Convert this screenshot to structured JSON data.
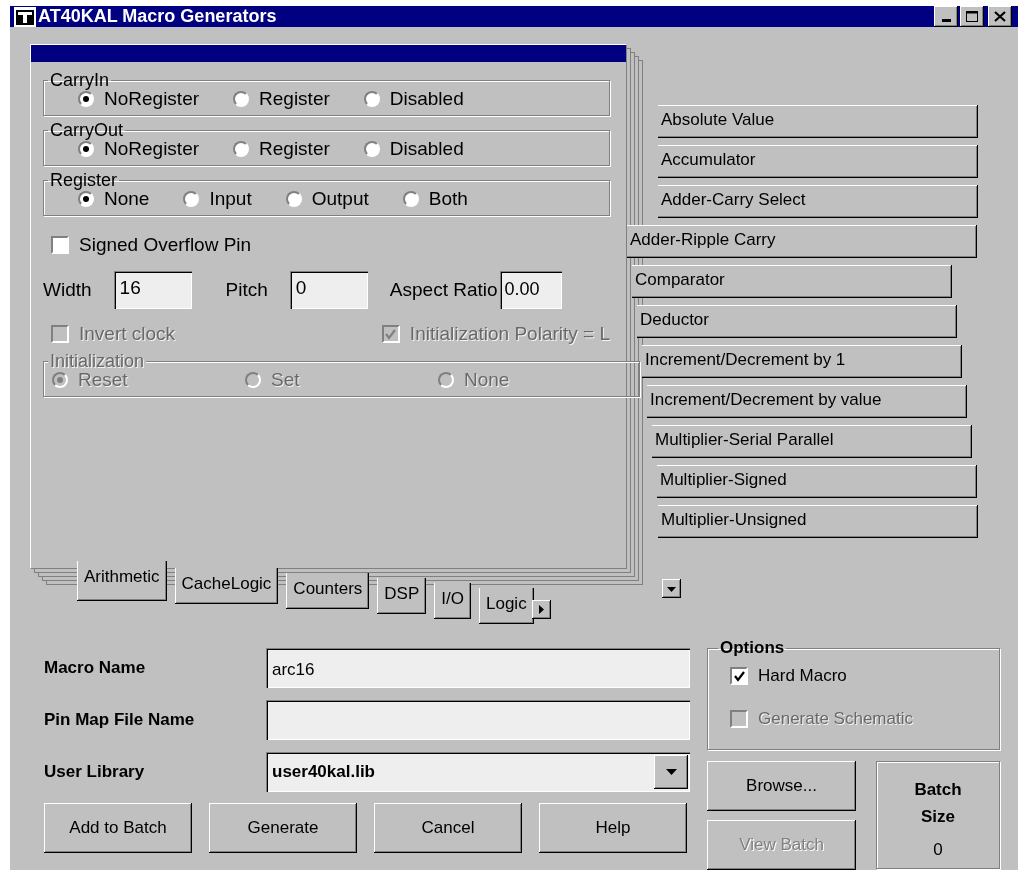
{
  "window": {
    "title": "AT40KAL Macro Generators"
  },
  "panel": {
    "groups": [
      {
        "title": "CarryIn",
        "disabled": false,
        "options": [
          {
            "label": "NoRegister",
            "selected": true
          },
          {
            "label": "Register",
            "selected": false
          },
          {
            "label": "Disabled",
            "selected": false
          }
        ]
      },
      {
        "title": "CarryOut",
        "disabled": false,
        "options": [
          {
            "label": "NoRegister",
            "selected": true
          },
          {
            "label": "Register",
            "selected": false
          },
          {
            "label": "Disabled",
            "selected": false
          }
        ]
      },
      {
        "title": "Register",
        "disabled": false,
        "options": [
          {
            "label": "None",
            "selected": true
          },
          {
            "label": "Input",
            "selected": false
          },
          {
            "label": "Output",
            "selected": false
          },
          {
            "label": "Both",
            "selected": false
          }
        ]
      }
    ],
    "signed_overflow": {
      "label": "Signed Overflow Pin",
      "checked": false,
      "disabled": false
    },
    "fields": [
      {
        "label": "Width",
        "value": "16"
      },
      {
        "label": "Pitch",
        "value": "0"
      },
      {
        "label": "Aspect Ratio",
        "value": "0.00"
      }
    ],
    "checks": [
      {
        "label": "Invert clock",
        "checked": false,
        "disabled": true
      },
      {
        "label": "Initialization Polarity = L",
        "checked": true,
        "disabled": true
      }
    ],
    "initialization": {
      "title": "Initialization",
      "disabled": true,
      "options": [
        {
          "label": "Reset",
          "selected": true
        },
        {
          "label": "Set",
          "selected": false
        },
        {
          "label": "None",
          "selected": false
        }
      ]
    }
  },
  "macro_list": [
    {
      "label": "Absolute Value",
      "selected": false
    },
    {
      "label": "Accumulator",
      "selected": false
    },
    {
      "label": "Adder-Carry Select",
      "selected": false
    },
    {
      "label": "Adder-Ripple Carry",
      "selected": true
    },
    {
      "label": "Comparator",
      "selected": false
    },
    {
      "label": "Deductor",
      "selected": false
    },
    {
      "label": "Increment/Decrement by 1",
      "selected": false
    },
    {
      "label": "Increment/Decrement by value",
      "selected": false
    },
    {
      "label": "Multiplier-Serial Parallel",
      "selected": false
    },
    {
      "label": "Multiplier-Signed",
      "selected": false
    },
    {
      "label": "Multiplier-Unsigned",
      "selected": false
    }
  ],
  "category_tabs": [
    {
      "label": "Arithmetic",
      "selected": true
    },
    {
      "label": "CacheLogic",
      "selected": false
    },
    {
      "label": "Counters",
      "selected": false
    },
    {
      "label": "DSP",
      "selected": false
    },
    {
      "label": "I/O",
      "selected": false
    },
    {
      "label": "Logic",
      "selected": false
    }
  ],
  "form": {
    "macro_name": {
      "label": "Macro Name",
      "value": "arc16"
    },
    "pin_map": {
      "label": "Pin Map File Name"
    },
    "user_library": {
      "label": "User Library",
      "value": "user40kal.lib"
    }
  },
  "options": {
    "title": "Options",
    "items": [
      {
        "label": "Hard Macro",
        "checked": true,
        "disabled": false
      },
      {
        "label": "Generate Schematic",
        "checked": false,
        "disabled": true
      }
    ]
  },
  "side_buttons": [
    {
      "label": "Browse...",
      "disabled": false
    },
    {
      "label": "View Batch",
      "disabled": true
    }
  ],
  "batch": {
    "label": "Batch Size",
    "value": "0"
  },
  "buttons": [
    {
      "label": "Add to Batch",
      "disabled": false
    },
    {
      "label": "Generate",
      "disabled": false
    },
    {
      "label": "Cancel",
      "disabled": false
    },
    {
      "label": "Help",
      "disabled": false
    }
  ]
}
